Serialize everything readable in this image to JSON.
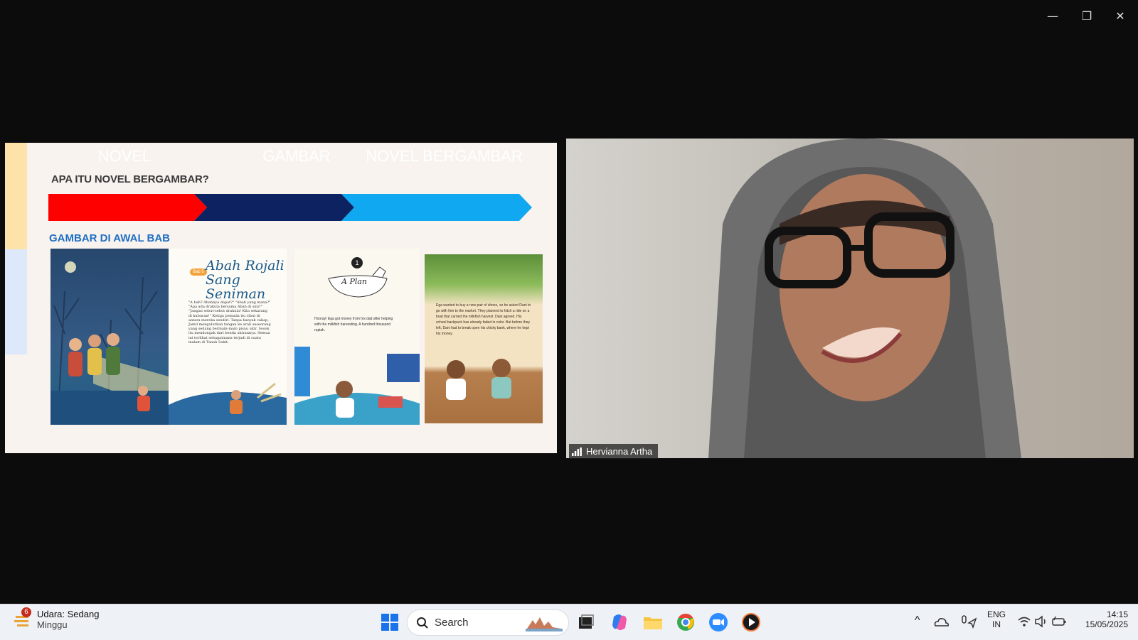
{
  "window_controls": {
    "minimize": "—",
    "restore": "❐",
    "close": "✕"
  },
  "slide": {
    "title": "APA ITU NOVEL BERGAMBAR?",
    "chevrons": [
      {
        "label": "NOVEL",
        "color": "#ff0000"
      },
      {
        "label": "GAMBAR",
        "color": "#0d2260"
      },
      {
        "label": "NOVEL BERGAMBAR",
        "color": "#10a8f0"
      }
    ],
    "subtitle": "GAMBAR DI AWAL BAB",
    "book1": {
      "tag": "Bab 5",
      "title_line1": "Abah Rojali",
      "title_line2": "Sang Seniman",
      "text": "\"A bah? Abahnya dapat?\" \"Abah yang mana?\" \"Apa ada drakula bersama Abah di sini?\" \"Jangan sebut-sebut drakula! Kita sekarang di kuburan!\" Ketiga pemuda itu ribut di antara mereka sendiri. Tanpa banyak cakap, Jamil mengulurkan tangan ke arah seseorang yang sedang bermain-main pisau ukir. Sosok itu mendongak dari benda ukirannya. Semua ini terlihat sebagaimana terjadi di suatu malam di Tanah Sakit."
    },
    "book2": {
      "chapter_number": "1",
      "chapter_title": "A Plan",
      "text_left": "Hooray! Ega got money from his dad after helping with the milkfish harvesting. A hundred thousand rupiah.",
      "text_right": "Ega wanted to buy a new pair of shoes, so he asked Dani to go with him to the market. They planned to hitch a ride on a boat that carried the milkfish harvest. Dani agreed. His school backpack has already faded in color. But before they left, Dani had to break open his chicky bank, where he kept his money."
    }
  },
  "video": {
    "participant_name": "Hervianna Artha"
  },
  "taskbar": {
    "weather_badge": "6",
    "weather_line1": "Udara: Sedang",
    "weather_line2": "Minggu",
    "search_label": "Search",
    "tray_chevron": "^",
    "lang_line1": "ENG",
    "lang_line2": "IN",
    "time": "14:15",
    "date": "15/05/2025"
  }
}
